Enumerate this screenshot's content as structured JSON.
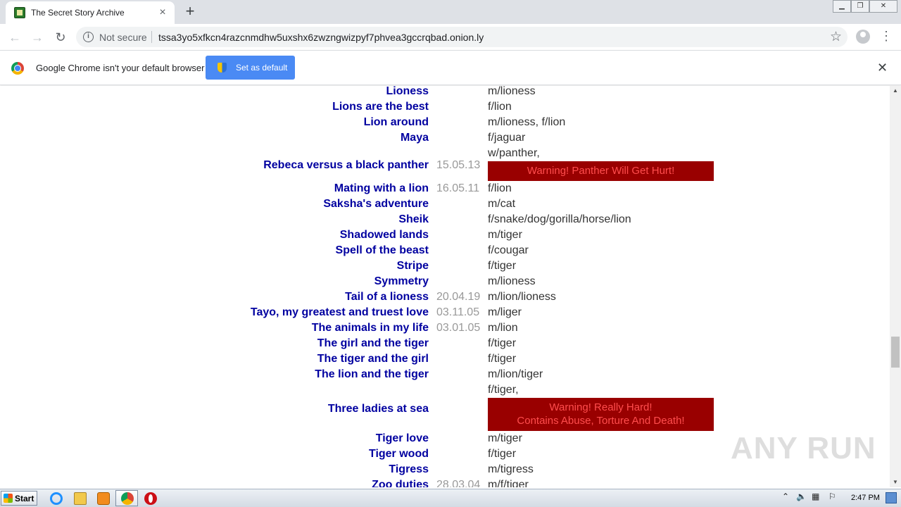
{
  "browser": {
    "tab": {
      "title": "The Secret Story Archive"
    },
    "address": {
      "security": "Not secure",
      "url": "tssa3yo5xfkcn4razcnmdhw5uxshx6zwzngwizpyf7phvea3gccrqbad.onion.ly"
    },
    "infobar": {
      "message": "Google Chrome isn't your default browser",
      "button": "Set as default"
    }
  },
  "stories": [
    {
      "title": "Lioness",
      "date": "",
      "tags": "m/lioness"
    },
    {
      "title": "Lions are the best",
      "date": "",
      "tags": "f/lion"
    },
    {
      "title": "Lion around",
      "date": "",
      "tags": "m/lioness, f/lion"
    },
    {
      "title": "Maya",
      "date": "",
      "tags": "f/jaguar"
    },
    {
      "title": "Rebeca versus a black panther",
      "date": "15.05.13",
      "tags": "w/panther,",
      "warning": [
        "Warning! Panther Will Get Hurt!"
      ]
    },
    {
      "title": "Mating with a lion",
      "date": "16.05.11",
      "tags": "f/lion"
    },
    {
      "title": "Saksha's adventure",
      "date": "",
      "tags": "m/cat"
    },
    {
      "title": "Sheik",
      "date": "",
      "tags": "f/snake/dog/gorilla/horse/lion"
    },
    {
      "title": "Shadowed lands",
      "date": "",
      "tags": "m/tiger"
    },
    {
      "title": "Spell of the beast",
      "date": "",
      "tags": "f/cougar"
    },
    {
      "title": "Stripe",
      "date": "",
      "tags": "f/tiger"
    },
    {
      "title": "Symmetry",
      "date": "",
      "tags": "m/lioness"
    },
    {
      "title": "Tail of a lioness",
      "date": "20.04.19",
      "tags": "m/lion/lioness"
    },
    {
      "title": "Tayo, my greatest and truest love",
      "date": "03.11.05",
      "tags": "m/liger"
    },
    {
      "title": "The animals in my life",
      "date": "03.01.05",
      "tags": "m/lion"
    },
    {
      "title": "The girl and the tiger",
      "date": "",
      "tags": "f/tiger"
    },
    {
      "title": "The tiger and the girl",
      "date": "",
      "tags": "f/tiger"
    },
    {
      "title": "The lion and the tiger",
      "date": "",
      "tags": "m/lion/tiger"
    },
    {
      "title": "Three ladies at sea",
      "date": "",
      "tags": "f/tiger,",
      "warning": [
        "Warning! Really Hard!",
        "Contains Abuse, Torture And Death!"
      ]
    },
    {
      "title": "Tiger love",
      "date": "",
      "tags": "m/tiger"
    },
    {
      "title": "Tiger wood",
      "date": "",
      "tags": "f/tiger"
    },
    {
      "title": "Tigress",
      "date": "",
      "tags": "m/tigress"
    },
    {
      "title": "Zoo duties",
      "date": "28.03.04",
      "tags": "m/f/tiger"
    }
  ],
  "watermark": "ANY RUN",
  "taskbar": {
    "start": "Start",
    "clock": "2:47 PM"
  },
  "colors": {
    "title": "#0000a0",
    "warning_bg": "#990000",
    "warning_text": "#ff4d4d"
  }
}
